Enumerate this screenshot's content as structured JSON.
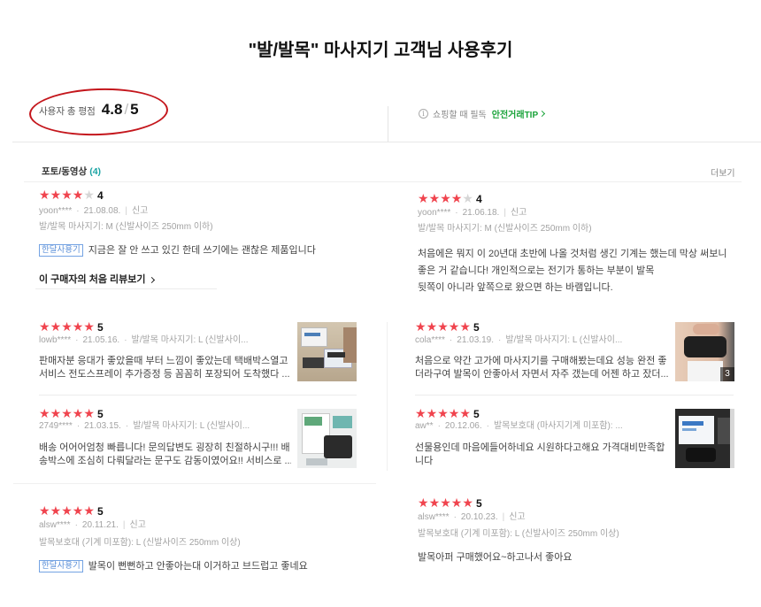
{
  "page": {
    "title": "\"발/발목\" 마사지기 고객님 사용후기"
  },
  "rating_summary": {
    "label": "사용자 총 평점",
    "score": "4.8",
    "slash": "/",
    "max": "5"
  },
  "notice": {
    "icon": "info-icon",
    "text": "쇼핑할 때 필독",
    "link_label": "안전거래TIP"
  },
  "photo_section": {
    "label": "포토/동영상",
    "count": "(4)",
    "more_label": "더보기"
  },
  "colors": {
    "star": "#f0444e",
    "highlight_circle": "#c4161c",
    "notice_link": "#1aa33a",
    "section_count": "#1aa3a3"
  },
  "reviews": [
    {
      "rating": "4",
      "user": "yoon****",
      "date": "21.08.08.",
      "report": "신고",
      "option": "발/발목 마사지기: M (신발사이즈 250mm 이하)",
      "badge": "한달사용기",
      "text": [
        "지금은 잘 안 쓰고 있긴 한데 쓰기에는 괜찮은 제품입니다"
      ],
      "first_review_link": "이 구매자의 처음 리뷰보기"
    },
    {
      "rating": "4",
      "user": "yoon****",
      "date": "21.06.18.",
      "report": "신고",
      "option": "발/발목 마사지기: M (신발사이즈 250mm 이하)",
      "text": [
        "처음에은 뭐지 이 20년대 초반에 나올 것처럼 생긴 기계는 했는데 막상 써보니",
        "좋은 거 같습니다! 개인적으로는 전기가 통하는 부분이 발목",
        "뒷쪽이 아니라 앞쪽으로 왔으면 하는 바램입니다."
      ]
    },
    {
      "rating": "5",
      "user": "lowb****",
      "date": "21.05.16.",
      "option": "발/발목 마사지기: L (신발사이...",
      "text": [
        "판매자분 응대가 좋았을때 부터 느낌이 좋았는데 택배박스열고",
        "서비스 전도스프레이 추가증정 등 꼼꼼히 포장되어 도착했다 ..."
      ]
    },
    {
      "rating": "5",
      "user": "cola****",
      "date": "21.03.19.",
      "option": "발/발목 마사지기: L (신발사이...",
      "photo_count": "3",
      "text": [
        "처음으로 약간 고가에 마사지기를 구매해봤는데요 성능 완전 좋",
        "더라구여 발목이 안좋아서 자면서 자주 갰는데 어젠 하고 잤더..."
      ]
    },
    {
      "rating": "5",
      "user": "2749****",
      "date": "21.03.15.",
      "option": "발/발목 마사지기: L (신발사이...",
      "text": [
        "배송 어어어엄청 빠릅니다! 문의답변도 굉장히 친절하시구!!! 배",
        "송박스에 조심히 다뤄달라는 문구도 감동이였어요!! 서비스로 ..."
      ]
    },
    {
      "rating": "5",
      "user": "aw**",
      "date": "20.12.06.",
      "option": "발목보호대 (마사지기계 미포함): ...",
      "text": [
        "선물용인데 마음에들어하네요 시원하다고해요 가격대비만족합",
        "니다"
      ]
    },
    {
      "rating": "5",
      "user": "alsw****",
      "date": "20.11.21.",
      "report": "신고",
      "option": "발목보호대 (기계 미포함): L (신발사이즈 250mm 이상)",
      "badge": "한달사용기",
      "text": [
        "발목이 뻔뻔하고 안좋아는대 이거하고 브드럽고 좋네요"
      ]
    },
    {
      "rating": "5",
      "user": "alsw****",
      "date": "20.10.23.",
      "report": "신고",
      "option": "발목보호대 (기계 미포함): L (신발사이즈 250mm 이상)",
      "text": [
        "발목아퍼 구매했어요~하고나서 좋아요"
      ]
    }
  ]
}
